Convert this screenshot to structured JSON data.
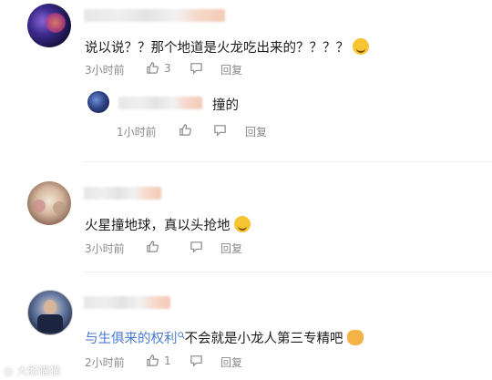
{
  "comments": [
    {
      "text": "说以说？？那个地道是火龙吃出来的？？？？",
      "time": "3小时前",
      "likes": "3",
      "reply_label": "回复",
      "emoji": "grimace-emoji",
      "reply": {
        "text": "撞的",
        "time": "1小时前",
        "reply_label": "回复"
      }
    },
    {
      "text": "火星撞地球，真以头抢地",
      "time": "3小时前",
      "reply_label": "回复",
      "emoji": "grimace-emoji"
    },
    {
      "link_text": "与生俱来的权利",
      "text": "不会就是小龙人第三专精吧",
      "time": "2小时前",
      "likes": "1",
      "reply_label": "回复",
      "emoji": "cat-emoji"
    }
  ],
  "watermark": "大脸猫猫",
  "colors": {
    "link": "#4a7bd0",
    "meta": "#8a8a8a",
    "divider": "#ededed"
  }
}
